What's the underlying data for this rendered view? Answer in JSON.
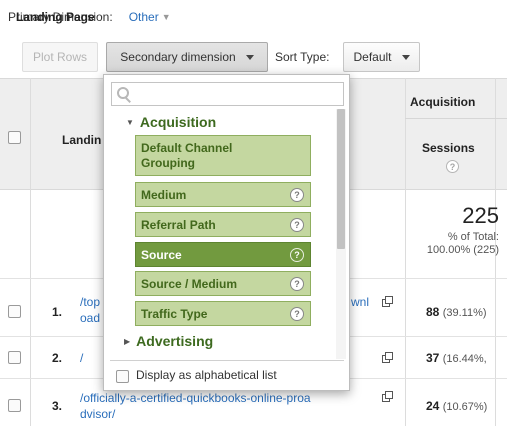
{
  "primary_dimension": {
    "label": "Primary Dimension:",
    "value": "Landing Page",
    "other": "Other"
  },
  "toolbar": {
    "plot_rows": "Plot Rows",
    "secondary_dimension": "Secondary dimension",
    "sort_type_label": "Sort Type:",
    "sort_type_value": "Default"
  },
  "table": {
    "group_header": "Acquisition",
    "column_landing": "Landin",
    "column_sessions": "Sessions",
    "totals": {
      "value": "225",
      "pct_line1": "% of Total:",
      "pct_line2": "100.00% (225)"
    },
    "rows": [
      {
        "num": "1.",
        "page_line1": "/top",
        "page_line1b": "wnl",
        "page_line2": "oad",
        "sessions": "88",
        "pct": "(39.11%)"
      },
      {
        "num": "2.",
        "page_line1": "/",
        "sessions": "37",
        "pct": "(16.44%,"
      },
      {
        "num": "3.",
        "page_line1": "/officially-a-certified-quickbooks-online-proa",
        "page_line2": "dvisor/",
        "sessions": "24",
        "pct": "(10.67%)"
      }
    ]
  },
  "dropdown": {
    "search_placeholder": "",
    "groups": [
      {
        "label": "Acquisition",
        "expanded": true
      },
      {
        "label": "Advertising",
        "expanded": false
      }
    ],
    "items": [
      {
        "label_line1": "Default Channel",
        "label_line2": "Grouping",
        "help": false
      },
      {
        "label": "Medium",
        "help": true
      },
      {
        "label": "Referral Path",
        "help": true
      },
      {
        "label": "Source",
        "help": true,
        "selected": true
      },
      {
        "label": "Source / Medium",
        "help": true
      },
      {
        "label": "Traffic Type",
        "help": true
      }
    ],
    "alphabetical_label": "Display as alphabetical list",
    "help_glyph": "?"
  },
  "colors": {
    "link": "#2a6ebb",
    "item_bg": "#c4d7a0",
    "item_selected_bg": "#729a3f",
    "group_text": "#3d6a1f"
  }
}
